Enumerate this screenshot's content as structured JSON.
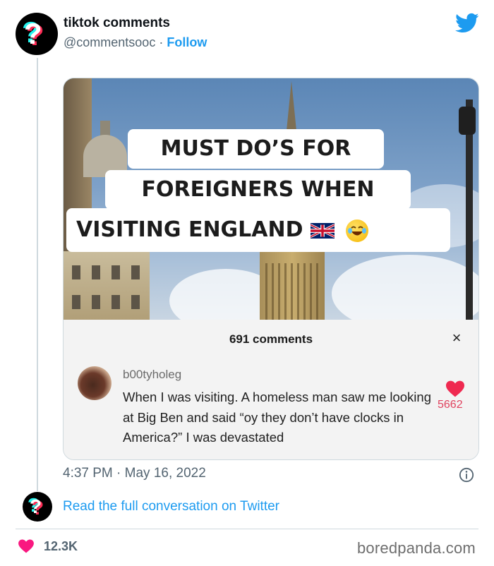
{
  "tweet": {
    "display_name": "tiktok comments",
    "handle": "@commentsooc",
    "separator": "·",
    "follow_label": "Follow",
    "timestamp": "4:37 PM · May 16, 2022",
    "read_more": "Read the full conversation on Twitter",
    "likes": "12.3K",
    "accent_color": "#1d9bf0",
    "heart_color": "#f91880"
  },
  "media": {
    "title_lines": [
      "MUST DO’S FOR",
      "FOREIGNERS WHEN",
      "VISITING  ENGLAND"
    ],
    "title_emojis": [
      "uk-flag-icon",
      "laughing-emoji-icon"
    ],
    "comments_header": "691 comments",
    "close_label": "×",
    "comment": {
      "username": "b00tyholeg",
      "text": "When I was visiting. A homeless man saw me looking at Big Ben and said “oy they don’t have clocks in America?” I was devastated",
      "likes": "5662"
    }
  },
  "watermark": "boredpanda.com"
}
